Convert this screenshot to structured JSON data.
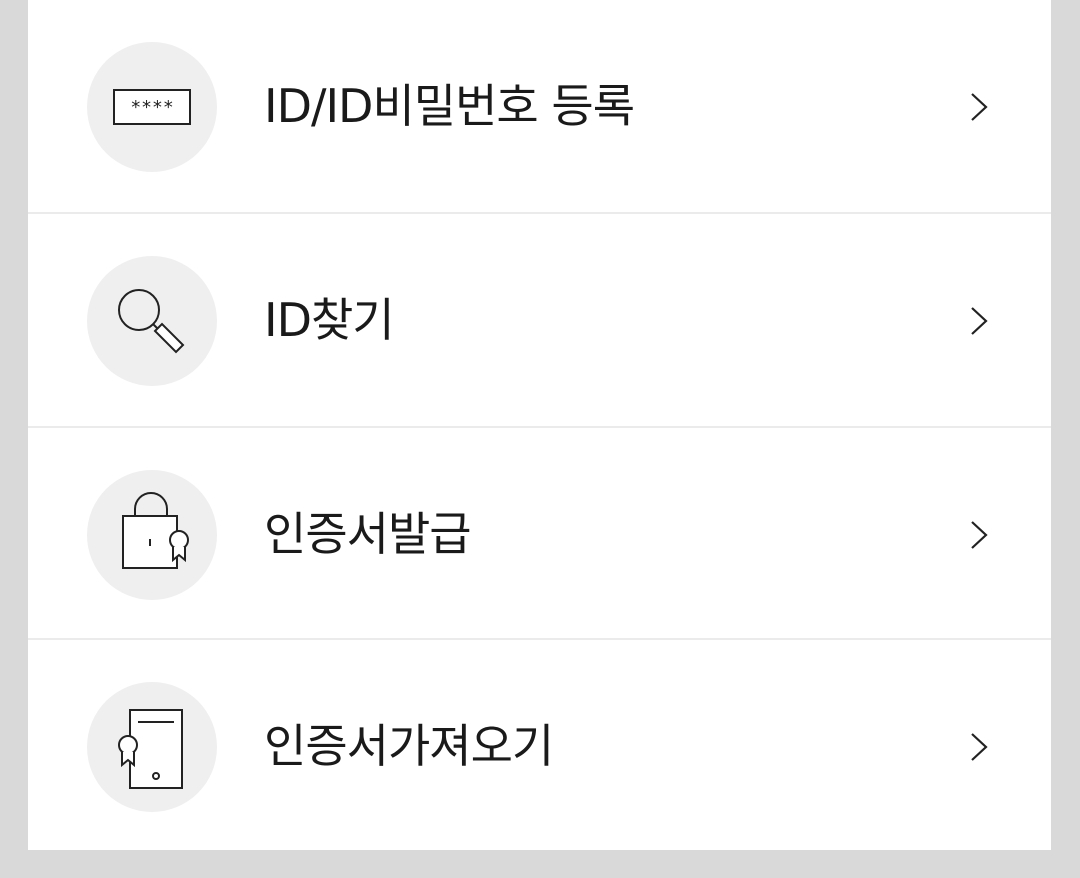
{
  "menu": {
    "items": [
      {
        "label": "ID/ID비밀번호 등록",
        "icon": "password-field-icon",
        "chevron": "chevron-right-icon"
      },
      {
        "label": "ID찾기",
        "icon": "magnifier-icon",
        "chevron": "chevron-right-icon"
      },
      {
        "label": "인증서발급",
        "icon": "lock-certificate-icon",
        "chevron": "chevron-right-icon"
      },
      {
        "label": "인증서가져오기",
        "icon": "device-certificate-icon",
        "chevron": "chevron-right-icon"
      }
    ]
  },
  "colors": {
    "background": "#d9d9d9",
    "card": "#ffffff",
    "icon_circle": "#efefef",
    "text": "#1a1a1a",
    "divider": "#ebebeb"
  }
}
